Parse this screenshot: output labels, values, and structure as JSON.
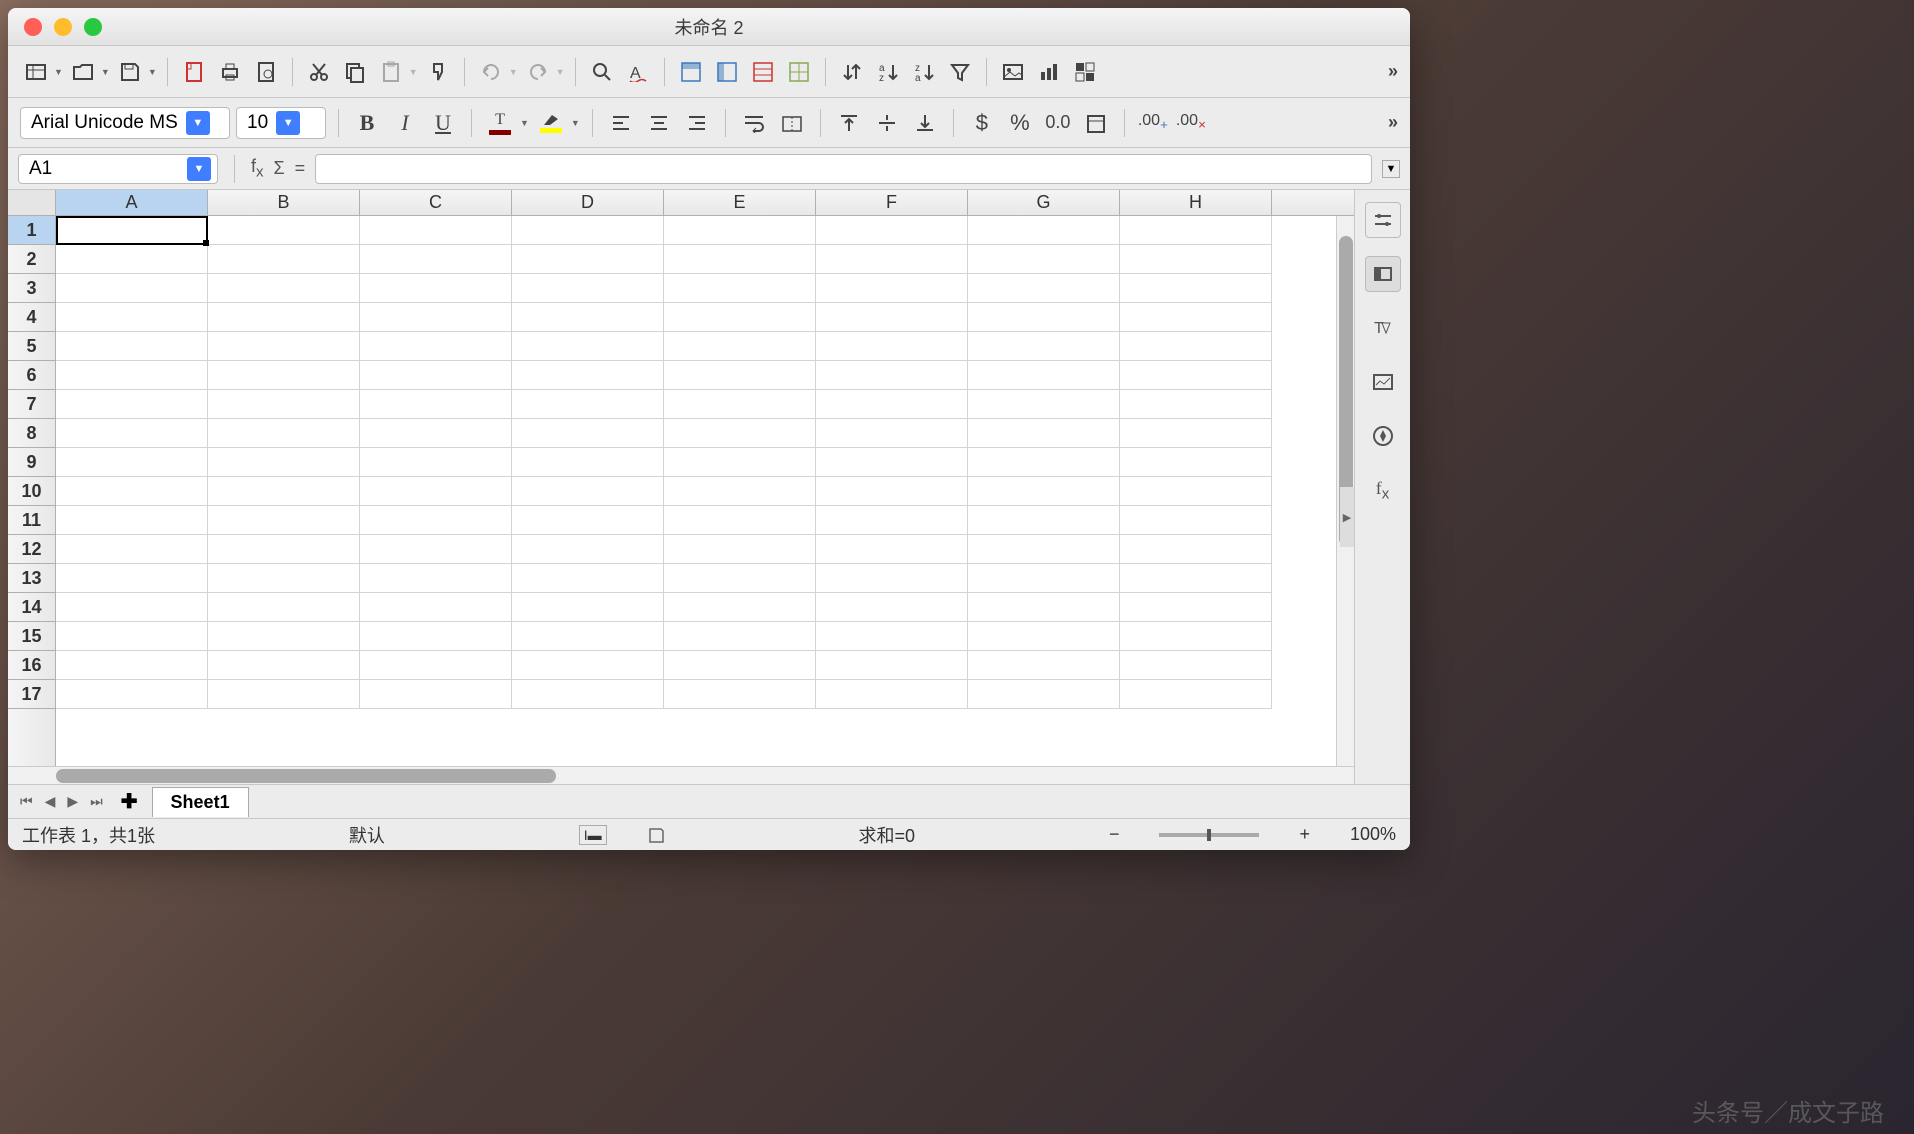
{
  "window": {
    "title": "未命名 2"
  },
  "toolbar": {
    "icons": [
      "new-doc",
      "open",
      "save",
      "export-pdf",
      "print",
      "print-preview",
      "cut",
      "copy",
      "paste",
      "clone-format",
      "format-paint",
      "undo",
      "redo",
      "find",
      "spellcheck",
      "row-header",
      "col-header",
      "freeze",
      "split",
      "sort",
      "sort-asc",
      "sort-desc",
      "autofilter",
      "image",
      "chart",
      "pivot"
    ]
  },
  "format": {
    "font_name": "Arial Unicode MS",
    "font_size": "10"
  },
  "formula": {
    "cell_ref": "A1",
    "formula_value": ""
  },
  "grid": {
    "columns": [
      "A",
      "B",
      "C",
      "D",
      "E",
      "F",
      "G",
      "H"
    ],
    "rows": [
      "1",
      "2",
      "3",
      "4",
      "5",
      "6",
      "7",
      "8",
      "9",
      "10",
      "11",
      "12",
      "13",
      "14",
      "15",
      "16",
      "17"
    ],
    "selected_col": "A",
    "selected_row": "1"
  },
  "tabs": {
    "sheet_name": "Sheet1"
  },
  "status": {
    "sheet_info": "工作表 1，共1张",
    "style": "默认",
    "sum": "求和=0",
    "zoom": "100%"
  },
  "watermark": "头条号／成文子路"
}
